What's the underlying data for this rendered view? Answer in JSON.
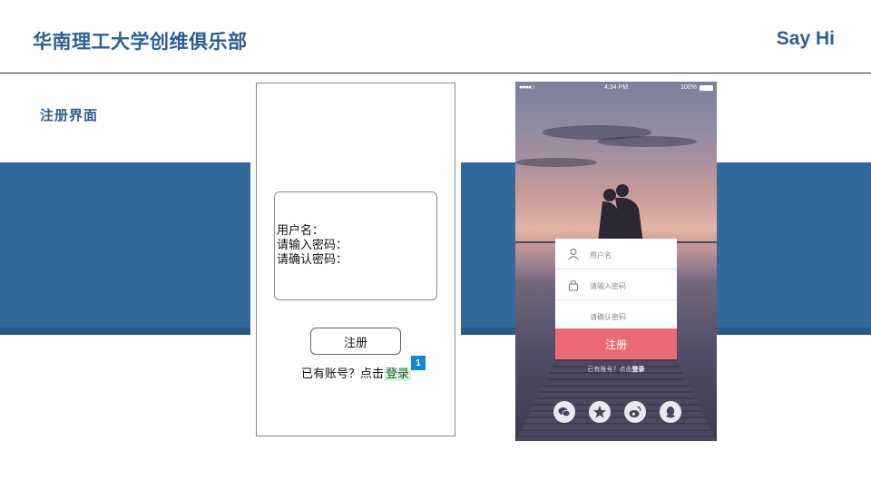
{
  "header": {
    "title": "华南理工大学创维俱乐部",
    "right_text": "Say Hi"
  },
  "page": {
    "subtitle": "注册界面"
  },
  "wireframe": {
    "fields": [
      "用户名：",
      "请输入密码：",
      "请确认密码："
    ],
    "button_label": "注册",
    "login_prefix": "已有账号？点击",
    "login_link": "登录",
    "badge": "1"
  },
  "mockup": {
    "status": {
      "signal": "●●●●○",
      "time": "4:34 PM",
      "battery": "100%"
    },
    "username_placeholder": "用户名",
    "password_placeholder": "请输入密码",
    "confirm_placeholder": "请确认密码",
    "submit_label": "注册",
    "footer_prefix": "已有账号？点击",
    "footer_link": "登录",
    "social_icons": [
      "wechat-icon",
      "qzone-icon",
      "weibo-icon",
      "qq-icon"
    ]
  },
  "colors": {
    "brand_blue": "#2d5f93",
    "band_blue": "#336a9c",
    "submit_pink": "#ec6a75",
    "badge_blue": "#0b8bd6"
  }
}
